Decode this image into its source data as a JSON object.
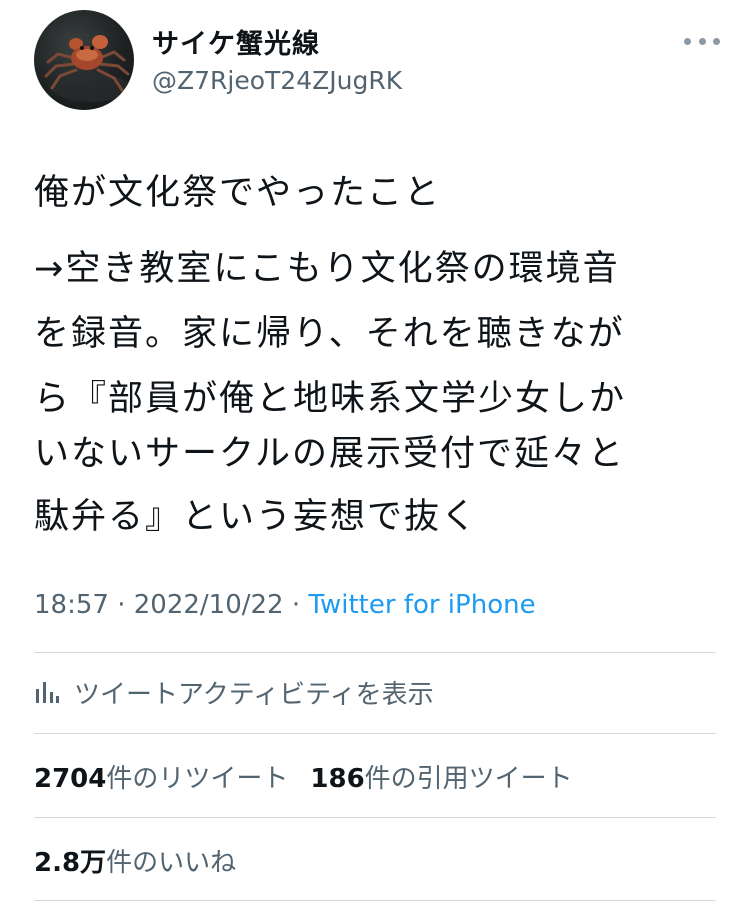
{
  "user": {
    "display_name": "サイケ蟹光線",
    "handle": "@Z7RjeoT24ZJugRK",
    "avatar_icon": "crab-avatar-icon"
  },
  "more_icon": "more-options-icon",
  "tweet": {
    "lines": [
      "俺が文化祭でやったこと",
      "→空き教室にこもり文化祭の環境音",
      "を録音。家に帰り、それを聴きなが",
      "ら『部員が俺と地味系文学少女しか",
      "いないサークルの展示受付で延々と",
      "駄弁る』という妄想で抜く"
    ]
  },
  "meta": {
    "time": "18:57",
    "separator1": " · ",
    "date": "2022/10/22",
    "separator2": " · ",
    "source": "Twitter for iPhone"
  },
  "activity": {
    "icon": "analytics-bars-icon",
    "label": "ツイートアクティビティを表示"
  },
  "stats": {
    "retweets_count": "2704",
    "retweets_label": "件のリツイート",
    "quotes_count": "186",
    "quotes_label": "件の引用ツイート",
    "likes_count": "2.8万",
    "likes_label": "件のいいね"
  },
  "colors": {
    "text": "#0f1419",
    "secondary": "#536471",
    "link": "#1d9bf0",
    "divider": "#cfd9de"
  }
}
